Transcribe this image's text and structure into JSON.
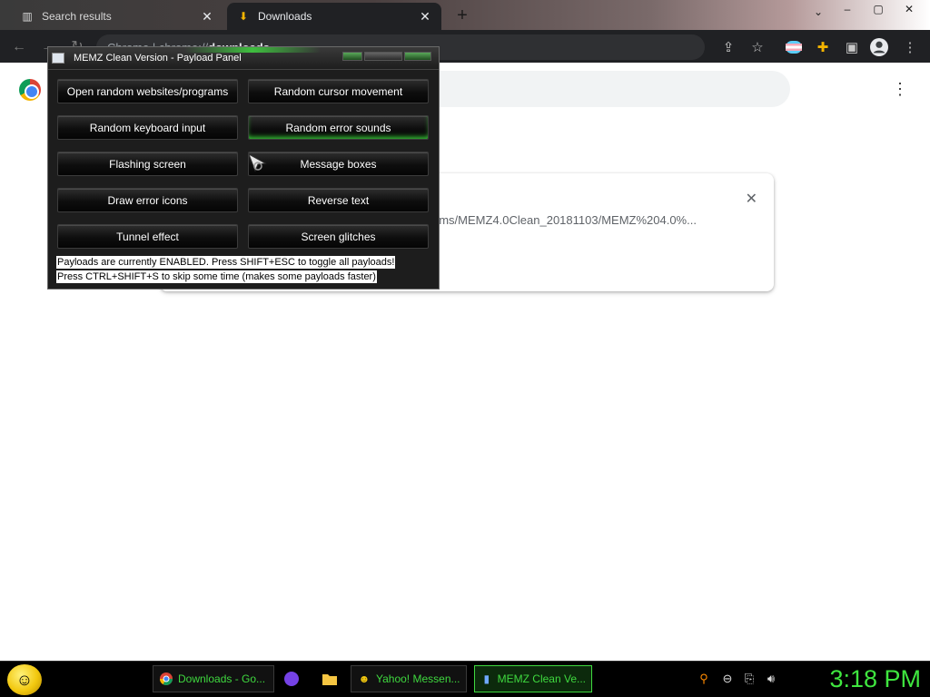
{
  "browser": {
    "tabs": [
      {
        "label": "Search results",
        "icon": "page-favicon",
        "close": "✕"
      },
      {
        "label": "Downloads",
        "icon": "download-icon",
        "close": "✕"
      }
    ],
    "newtab": "+",
    "window_controls": [
      "–",
      "▢",
      "✕"
    ],
    "tab_dropdown": "⌄",
    "address": {
      "prefix": "Chrome",
      "separator": "|",
      "scheme": "chrome://",
      "host": "downloads"
    },
    "toolbar_icons": [
      "share-icon",
      "star-icon",
      "extension-puzzle-icon",
      "side-panel-icon",
      "profile-icon",
      "menu-icon"
    ]
  },
  "downloads": {
    "menu": "⋮",
    "card": {
      "close": "✕",
      "path": "ems/MEMZ4.0Clean_20181103/MEMZ%204.0%..."
    }
  },
  "memz": {
    "title": "MEMZ Clean Version - Payload Panel",
    "payloads": [
      {
        "label": "Open random websites/programs",
        "hot": false
      },
      {
        "label": "Random cursor movement",
        "hot": false
      },
      {
        "label": "Random keyboard input",
        "hot": false
      },
      {
        "label": "Random error sounds",
        "hot": true
      },
      {
        "label": "Flashing screen",
        "hot": false
      },
      {
        "label": "Message boxes",
        "hot": false
      },
      {
        "label": "Draw error icons",
        "hot": false
      },
      {
        "label": "Reverse text",
        "hot": false
      },
      {
        "label": "Tunnel effect",
        "hot": false
      },
      {
        "label": "Screen glitches",
        "hot": false
      }
    ],
    "status_enabled": "Payloads are currently ENABLED. Press SHIFT+ESC to toggle all payloads!",
    "status_skip": "Press CTRL+SHIFT+S to skip some time (makes some payloads faster)"
  },
  "taskbar": {
    "tasks": [
      {
        "label": "Downloads - Go...",
        "icon": "chrome-icon"
      },
      {
        "label": "Yahoo! Messen...",
        "icon": "smiley-icon"
      },
      {
        "label": "MEMZ Clean Ve...",
        "icon": "memz-icon",
        "active": true
      }
    ],
    "quick_launch": [
      "firefox-icon",
      "folder-icon"
    ],
    "tray": [
      "search-icon",
      "minus-circle-icon",
      "network-icon",
      "volume-icon"
    ],
    "clock": "3:18 PM"
  },
  "colors": {
    "accent": "#3fd93f",
    "chrome_dark": "#202124",
    "panel": "#1d1d1d"
  }
}
